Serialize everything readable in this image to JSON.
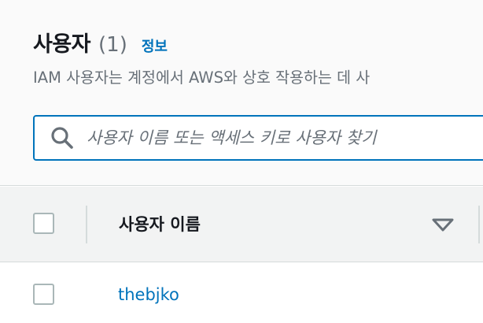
{
  "header": {
    "title": "사용자",
    "count": "(1)",
    "info_link": "정보",
    "description": "IAM 사용자는 계정에서 AWS와 상호 작용하는 데 사"
  },
  "search": {
    "placeholder": "사용자 이름 또는 액세스 키로 사용자 찾기",
    "icon": "search-icon"
  },
  "table": {
    "columns": [
      {
        "label": "사용자 이름",
        "sort_icon": "sort-descending-icon"
      }
    ],
    "rows": [
      {
        "user_name": "thebjko",
        "selected": false
      }
    ]
  },
  "colors": {
    "link": "#0073bb",
    "focus_border": "#0073bb",
    "header_bg": "#fafafa",
    "table_header_bg": "#f2f3f3",
    "muted_text": "#687078"
  }
}
